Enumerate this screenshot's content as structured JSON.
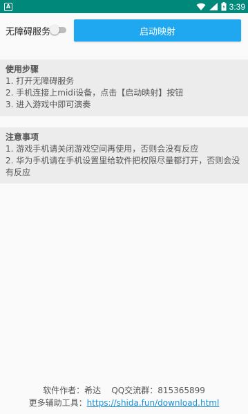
{
  "status_bar": {
    "notification_icon_letter": "A",
    "time": "3:39",
    "icons": [
      "wifi-icon",
      "signal-icon",
      "battery-icon"
    ]
  },
  "controls": {
    "service_label": "无障碍服务",
    "service_enabled": false,
    "start_button_label": "启动映射"
  },
  "usage": {
    "title": "使用步骤",
    "items": [
      "1. 打开无障碍服务",
      "2. 手机连接上midi设备，点击【启动映射】按钮",
      "3. 进入游戏中即可演奏"
    ]
  },
  "notes": {
    "title": "注意事项",
    "items": [
      "1. 游戏手机请关闭游戏空间再使用，否则会没有反应",
      "2. 华为手机请在手机设置里给软件把权限尽量都打开，否则会没有反应"
    ]
  },
  "footer": {
    "author_line": "软件作者：希达    QQ交流群：815365899",
    "tools_label": "更多辅助工具：",
    "tools_link": "https://shida.fun/download.html"
  },
  "colors": {
    "status_bar": "#00897b",
    "accent_button": "#1fa8ef",
    "link": "#1a8fd6"
  }
}
